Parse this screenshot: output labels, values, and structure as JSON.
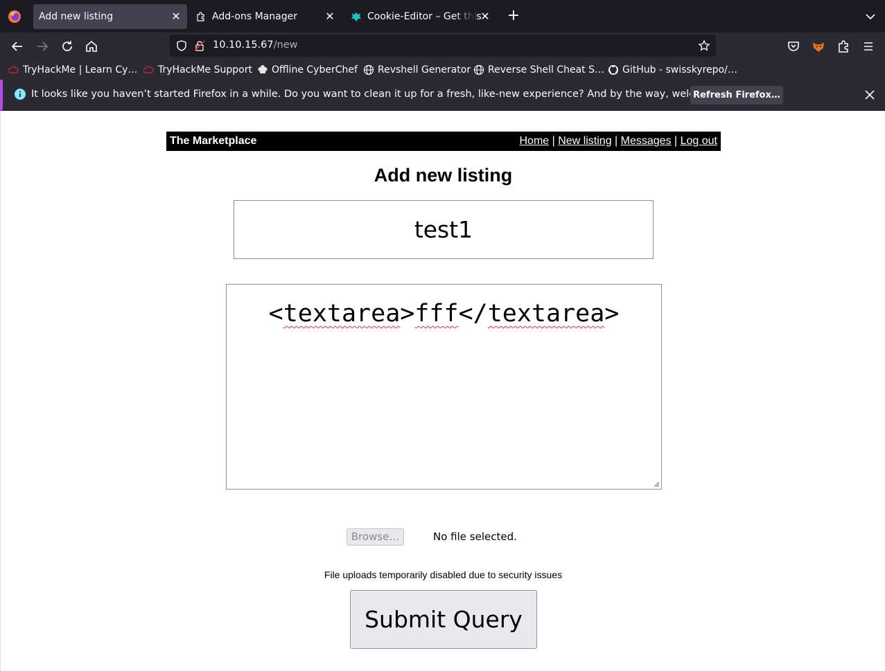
{
  "browser": {
    "tabs": [
      {
        "label": "Add new listing",
        "active": true
      },
      {
        "label": "Add-ons Manager",
        "active": false
      },
      {
        "label": "Cookie-Editor – Get this E",
        "active": false
      }
    ],
    "url": {
      "host": "10.10.15.67",
      "path": "/new"
    },
    "bookmarks": [
      "TryHackMe | Learn Cy…",
      "TryHackMe Support",
      "Offline CyberChef",
      "Revshell Generator",
      "Reverse Shell Cheat S…",
      "GitHub - swisskyrepo/…"
    ],
    "notification": {
      "text": "It looks like you haven’t started Firefox in a while. Do you want to clean it up for a fresh, like-new experience? And by the way, welcome back!",
      "button": "Refresh Firefox…"
    },
    "colors": {
      "tabbar": "#1c1b22",
      "toolbar": "#2b2a33",
      "notification_accent": "#b24ce6"
    }
  },
  "site": {
    "title": "The Marketplace",
    "nav": {
      "home": "Home",
      "new_listing": "New listing",
      "messages": "Messages",
      "logout": "Log out",
      "separator": " | "
    }
  },
  "form": {
    "heading": "Add new listing",
    "title_value": "test1",
    "description_parts": [
      "<",
      "textarea",
      ">",
      "fff",
      "</",
      "textarea",
      ">"
    ],
    "browse_label": "Browse…",
    "file_status": "No file selected.",
    "upload_note": "File uploads temporarily disabled due to security issues",
    "submit_label": "Submit Query"
  }
}
